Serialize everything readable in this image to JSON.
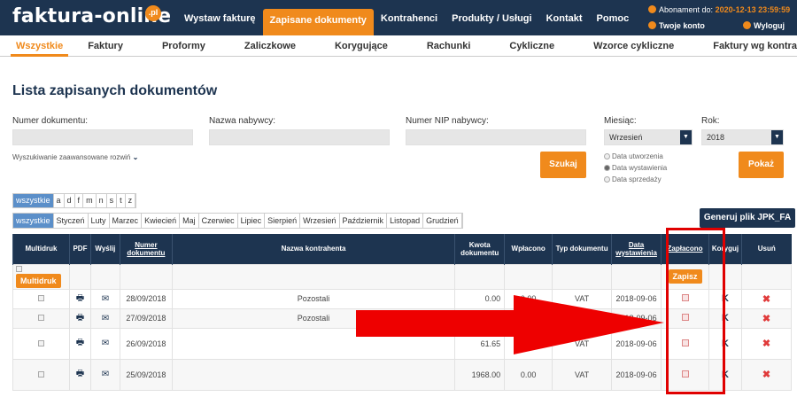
{
  "header": {
    "logo_text": "faktura-online",
    "logo_badge": ".pl",
    "nav": [
      "Wystaw fakturę",
      "Zapisane dokumenty",
      "Kontrahenci",
      "Produkty / Usługi",
      "Kontakt",
      "Pomoc"
    ],
    "subscription_label": "Abonament do:",
    "subscription_date": "2020-12-13 23:59:59",
    "account_label": "Twoje konto",
    "logout_label": "Wyloguj"
  },
  "subnav": [
    "Wszystkie",
    "Faktury",
    "Proformy",
    "Zaliczkowe",
    "Korygujące",
    "Rachunki",
    "Cykliczne",
    "Wzorce cykliczne",
    "Faktury wg kontrahentów"
  ],
  "page_title": "Lista zapisanych dokumentów",
  "filters": {
    "doc_number_label": "Numer dokumentu:",
    "buyer_name_label": "Nazwa nabywcy:",
    "buyer_nip_label": "Numer NIP nabywcy:",
    "month_label": "Miesiąc:",
    "month_value": "Wrzesień",
    "year_label": "Rok:",
    "year_value": "2018",
    "advanced_search": "Wyszukiwanie zaawansowane rozwiń",
    "search_button": "Szukaj",
    "show_button": "Pokaż",
    "radio_options": [
      "Data utworzenia",
      "Data wystawienia",
      "Data sprzedaży"
    ]
  },
  "letters": [
    "wszystkie",
    "a",
    "d",
    "f",
    "m",
    "n",
    "s",
    "t",
    "z"
  ],
  "months": [
    "wszystkie",
    "Styczeń",
    "Luty",
    "Marzec",
    "Kwiecień",
    "Maj",
    "Czerwiec",
    "Lipiec",
    "Sierpień",
    "Wrzesień",
    "Październik",
    "Listopad",
    "Grudzień"
  ],
  "jpk_button": "Generuj plik JPK_FA",
  "table": {
    "headers": {
      "multidruk": "Multidruk",
      "pdf": "PDF",
      "wyslij": "Wyślij",
      "numer": "Numer dokumentu",
      "nazwa": "Nazwa kontrahenta",
      "kwota": "Kwota dokumentu",
      "wplacono": "Wpłacono",
      "typ": "Typ dokumentu",
      "data": "Data wystawienia",
      "zaplacono": "Zapłacono",
      "koryguj": "Koryguj",
      "usun": "Usuń"
    },
    "multidruk_button": "Multidruk",
    "save_button": "Zapisz",
    "rows": [
      {
        "numer": "28/09/2018",
        "nazwa": "Pozostali",
        "kwota": "0.00",
        "wplacono": "0.00",
        "typ": "VAT",
        "data": "2018-09-06",
        "koryguj": "K",
        "usun": "✖"
      },
      {
        "numer": "27/09/2018",
        "nazwa": "Pozostali",
        "kwota": "",
        "wplacono": "0.00",
        "typ": "VAT",
        "data": "2018-09-06",
        "koryguj": "K",
        "usun": "✖"
      },
      {
        "numer": "26/09/2018",
        "nazwa": "",
        "kwota": "61.65",
        "wplacono": "0.00",
        "typ": "VAT",
        "data": "2018-09-06",
        "koryguj": "K",
        "usun": "✖"
      },
      {
        "numer": "25/09/2018",
        "nazwa": "",
        "kwota": "1968.00",
        "wplacono": "0.00",
        "typ": "VAT",
        "data": "2018-09-06",
        "koryguj": "K",
        "usun": "✖"
      }
    ]
  },
  "colors": {
    "navy": "#1d3450",
    "orange": "#f08a1c",
    "highlight": "#e00000"
  }
}
